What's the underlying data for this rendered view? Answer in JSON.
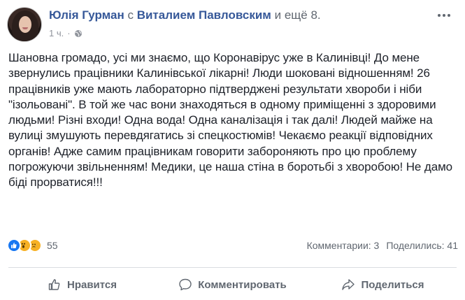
{
  "post": {
    "author": "Юлія Гурман",
    "connector": "с",
    "tagged": "Виталием Павловским",
    "and_more": "и ещё 8.",
    "time": "1 ч.",
    "separator": "·",
    "text": "Шановна громадо, усі ми знаємо, що Коронавірус уже в Калинівці! До мене звернулись працівники Калинівської лікарні! Люди шоковані відношенням! 26 працівників уже мають лабораторно підтверджені результати хвороби і ніби \"ізольовані\". В той же час вони знаходяться в одному приміщенні з здоровими людьми! Різні входи! Одна вода! Одна каналізація і так далі! Людей майже на вулиці змушують перевдягатись зі спецкостюмів! Чекаємо реакції відповідних органів! Адже самим працівникам говорити забороняють про цю проблему погрожуючи звільненням! Медики, це наша стіна в боротьбі з хворобою! Не дамо біді прорватися!!!"
  },
  "stats": {
    "reaction_count": "55",
    "comments": "Комментарии: 3",
    "shares": "Поделились: 41",
    "reaction_icons": [
      "like-icon",
      "wow-icon",
      "sad-icon"
    ]
  },
  "actions": {
    "like": "Нравится",
    "comment": "Комментировать",
    "share": "Поделиться"
  },
  "colors": {
    "link": "#365899",
    "meta": "#90949c",
    "action": "#606770",
    "like_blue": "#1877f2",
    "reaction_yellow": "#f7b125"
  }
}
